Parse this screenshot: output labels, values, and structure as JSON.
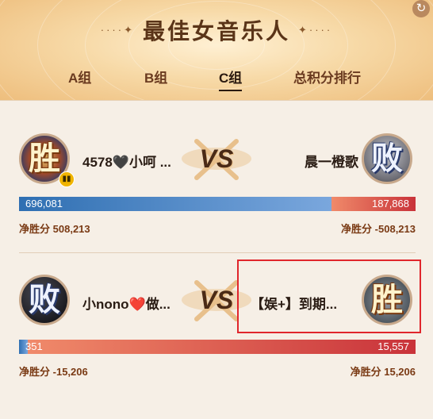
{
  "header": {
    "title": "最佳女音乐人",
    "left_deco": "····✦",
    "right_deco": "✦····"
  },
  "tabs": [
    {
      "label": "A组",
      "active": false
    },
    {
      "label": "B组",
      "active": false
    },
    {
      "label": "C组",
      "active": true
    },
    {
      "label": "总积分排行",
      "active": false
    }
  ],
  "matches": [
    {
      "left": {
        "name": "4578🖤小呵 ...",
        "badge": "胜",
        "result": "win",
        "votes": "696,081",
        "net_label": "净胜分",
        "net": "508,213",
        "has_level_icon": true
      },
      "right": {
        "name": "晨一橙歌",
        "badge": "败",
        "result": "lose",
        "votes": "187,868",
        "net_label": "净胜分",
        "net": "-508,213"
      },
      "vs": "VS",
      "left_share": 0.787
    },
    {
      "left": {
        "name": "小nono❤️做...",
        "badge": "败",
        "result": "lose",
        "votes": "351",
        "net_label": "净胜分",
        "net": "-15,206"
      },
      "right": {
        "name": "【娱+】到期...",
        "badge": "胜",
        "result": "win",
        "votes": "15,557",
        "net_label": "净胜分",
        "net": "15,206"
      },
      "vs": "VS",
      "left_share": 0.022
    }
  ],
  "colors": {
    "blue_start": "#2f6fb2",
    "blue_end": "#7aa7dd",
    "red_start": "#f08a6a",
    "red_end": "#c9333a",
    "highlight": "#e0262c"
  }
}
